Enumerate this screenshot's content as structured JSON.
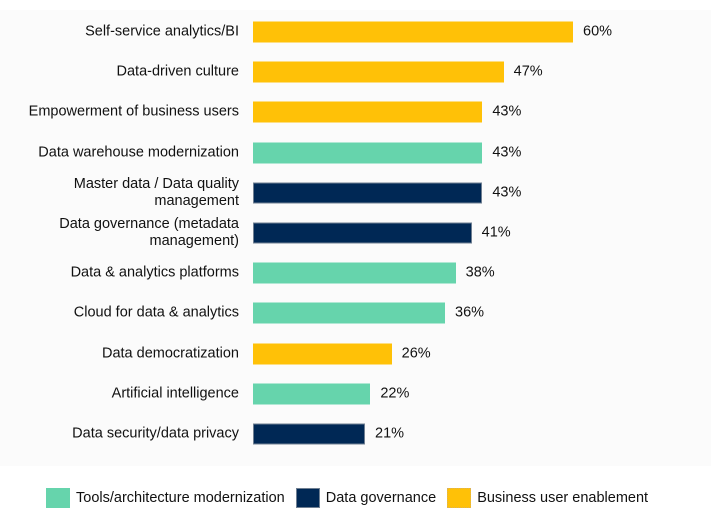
{
  "chart_data": {
    "type": "bar",
    "orientation": "horizontal",
    "title": "",
    "xlabel": "",
    "ylabel": "",
    "xlim": [
      0,
      60
    ],
    "grid": false,
    "value_format": "percent",
    "legend_position": "bottom",
    "categories": [
      "Self-service analytics/BI",
      "Data-driven culture",
      "Empowerment of business users",
      "Data warehouse modernization",
      "Master data / Data quality\nmanagement",
      "Data governance (metadata\nmanagement)",
      "Data & analytics platforms",
      "Cloud for data & analytics",
      "Data democratization",
      "Artificial intelligence",
      "Data security/data privacy"
    ],
    "values": [
      60,
      47,
      43,
      43,
      43,
      41,
      38,
      36,
      26,
      22,
      21
    ],
    "value_labels": [
      "60%",
      "47%",
      "43%",
      "43%",
      "43%",
      "41%",
      "38%",
      "36%",
      "26%",
      "22%",
      "21%"
    ],
    "groups": [
      "business",
      "business",
      "business",
      "tools",
      "governance",
      "governance",
      "tools",
      "tools",
      "business",
      "tools",
      "governance"
    ],
    "legend": [
      {
        "key": "tools",
        "label": "Tools/architecture modernization",
        "color": "#66D4AC"
      },
      {
        "key": "governance",
        "label": "Data governance",
        "color": "#002855"
      },
      {
        "key": "business",
        "label": "Business user enablement",
        "color": "#FFC107"
      }
    ]
  }
}
